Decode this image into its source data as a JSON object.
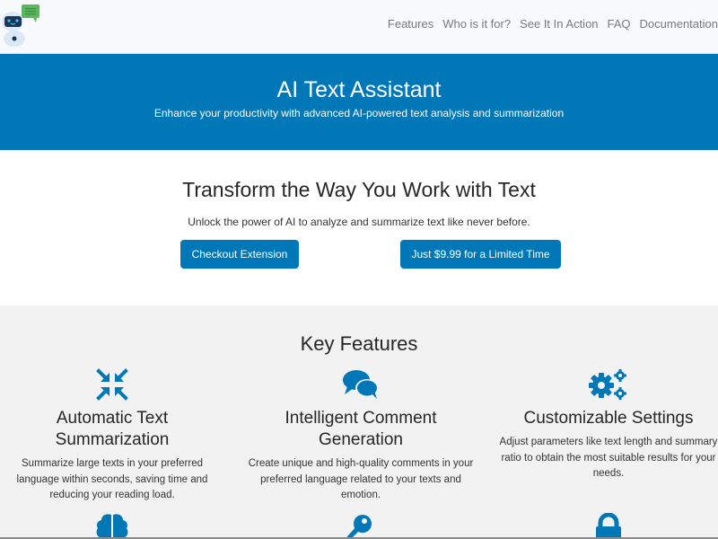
{
  "navbar": {
    "logo_icon": "robot-chat-icon",
    "links": [
      "Features",
      "Who is it for?",
      "See It In Action",
      "FAQ",
      "Documentation"
    ]
  },
  "hero": {
    "title": "AI Text Assistant",
    "subtitle": "Enhance your productivity with advanced AI-powered text analysis and summarization"
  },
  "intro": {
    "heading": "Transform the Way You Work with Text",
    "text": "Unlock the power of AI to analyze and summarize text like never before.",
    "checkout_label": "Checkout Extension",
    "price_label": "Just $9.99 for a Limited Time"
  },
  "features": {
    "heading": "Key Features",
    "items": [
      {
        "icon": "compress-arrows-icon",
        "title": "Automatic Text Summarization",
        "description": "Summarize large texts in your preferred language within seconds, saving time and reducing your reading load."
      },
      {
        "icon": "comments-icon",
        "title": "Intelligent Comment Generation",
        "description": "Create unique and high-quality comments in your preferred language related to your texts and emotion."
      },
      {
        "icon": "cogs-icon",
        "title": "Customizable Settings",
        "description": "Adjust parameters like text length and summary ratio to obtain the most suitable results for your needs."
      }
    ],
    "next_row_icons": [
      "brain-icon",
      "key-icon",
      "lock-icon"
    ]
  },
  "colors": {
    "primary": "#0077b6",
    "navbar_bg": "#f8f9fa",
    "features_bg": "#f2f2f2",
    "nav_text": "#7a7a7a"
  }
}
